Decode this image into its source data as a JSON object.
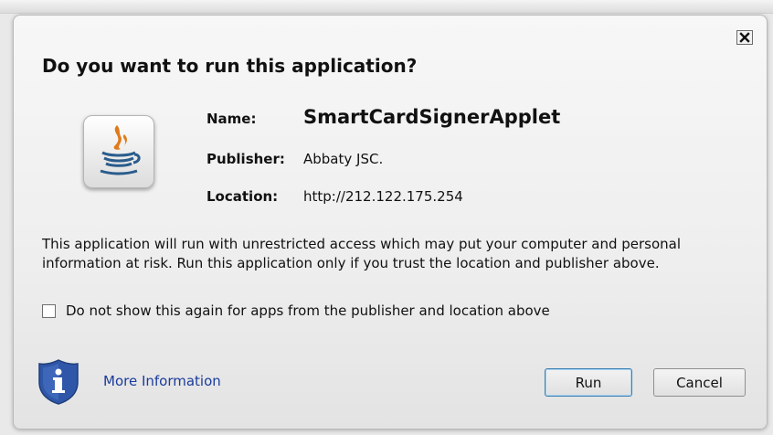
{
  "dialog": {
    "title": "Do you want to run this application?",
    "close_icon": "close-icon"
  },
  "app": {
    "icon": "java-cup-icon",
    "name_label": "Name:",
    "name": "SmartCardSignerApplet",
    "publisher_label": "Publisher:",
    "publisher": "Abbaty JSC.",
    "location_label": "Location:",
    "location": "http://212.122.175.254"
  },
  "warning": {
    "line1": "This application will run with unrestricted access which may put your computer and personal",
    "line2": "information at risk. Run this application only if you trust the location and publisher above."
  },
  "checkbox": {
    "label": "Do not show this again for apps from the publisher and location above",
    "checked": false
  },
  "footer": {
    "info_icon": "shield-info-icon",
    "more_info": "More Information",
    "run_label": "Run",
    "cancel_label": "Cancel"
  },
  "colors": {
    "link": "#1a3c9b",
    "java_orange": "#e07b1b",
    "java_blue": "#2a5c8c",
    "shield_blue": "#2f56a8"
  }
}
